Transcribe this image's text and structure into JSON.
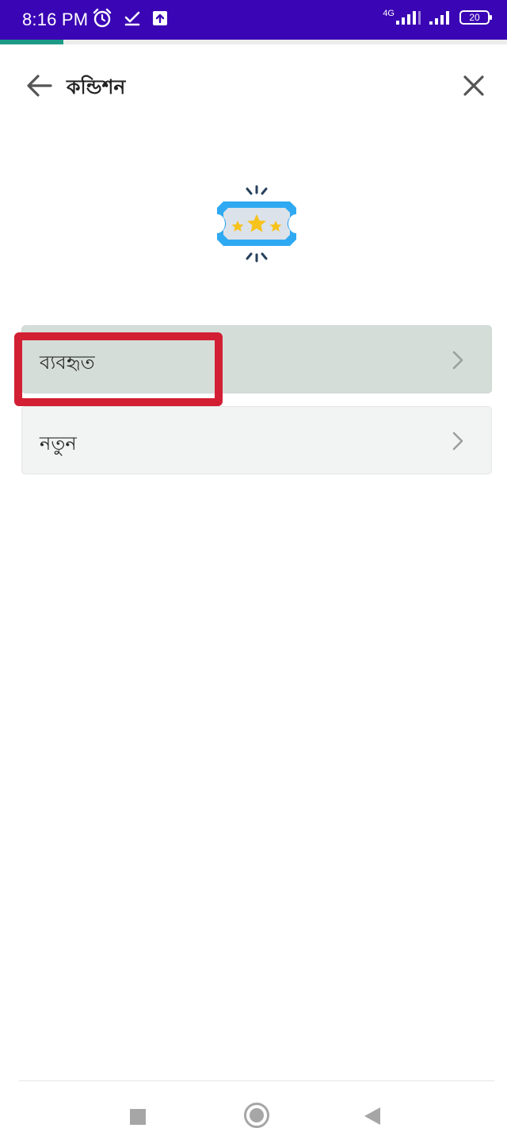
{
  "status_bar": {
    "time": "8:16 PM",
    "network_label": "4G",
    "battery": "20",
    "icons": [
      "alarm-icon",
      "check-download-icon",
      "upload-icon",
      "signal-icon",
      "signal-icon",
      "battery-icon"
    ]
  },
  "progress": {
    "fraction": 0.125,
    "color": "#1c9a86"
  },
  "header": {
    "title": "কন্ডিশন",
    "back_icon": "arrow-left-icon",
    "close_icon": "close-icon"
  },
  "illustration": {
    "icon": "stars-ticket-icon"
  },
  "options": [
    {
      "label": "ব্যবহৃত",
      "icon": "chevron-right-icon",
      "selected": true
    },
    {
      "label": "নতুন",
      "icon": "chevron-right-icon",
      "selected": false
    }
  ],
  "nav_bar": {
    "icons": [
      "recent-apps-icon",
      "home-icon",
      "back-triangle-icon"
    ]
  },
  "colors": {
    "status_bar": "#3a05b4",
    "highlight": "#d21f33",
    "selected_option_bg": "#d5ddd9",
    "option_bg": "#f2f4f3"
  }
}
